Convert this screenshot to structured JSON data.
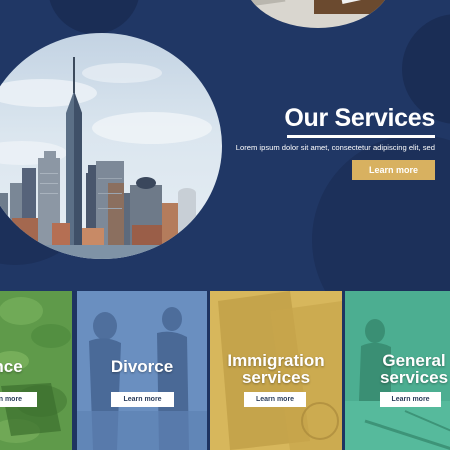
{
  "hero": {
    "title": "Our Services",
    "subtitle": "Lorem ipsum dolor sit amet, consectetur adipiscing elit, sed",
    "button_label": "Learn more"
  },
  "cards": [
    {
      "title": "Insurance",
      "button_label": "Learn more"
    },
    {
      "title": "Divorce",
      "button_label": "Learn more"
    },
    {
      "title_line1": "Immigration",
      "title_line2": "services",
      "button_label": "Learn more"
    },
    {
      "title_line1": "General",
      "title_line2": "services",
      "button_label": "Learn more"
    }
  ],
  "colors": {
    "background": "#1f3562",
    "accent_gold": "#d8b160",
    "card_green": "#5f9a4a",
    "card_blue": "#6489bb",
    "card_yellow": "#d4b458",
    "card_teal": "#48aa8d"
  }
}
